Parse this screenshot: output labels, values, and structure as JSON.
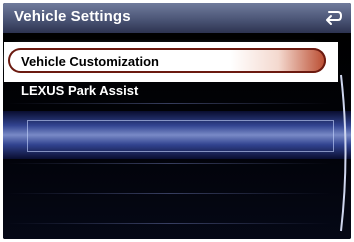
{
  "header": {
    "title": "Vehicle Settings",
    "back_icon": "return-arrow-icon"
  },
  "menu": {
    "items": [
      {
        "label": "Vehicle Customization",
        "selected": true
      },
      {
        "label": "LEXUS Park Assist",
        "selected": false
      }
    ]
  },
  "colors": {
    "header_top": "#707b9c",
    "header_bottom": "#2d3350",
    "selection_accent": "#b94a2e",
    "band_highlight": "#8ea2e8"
  }
}
